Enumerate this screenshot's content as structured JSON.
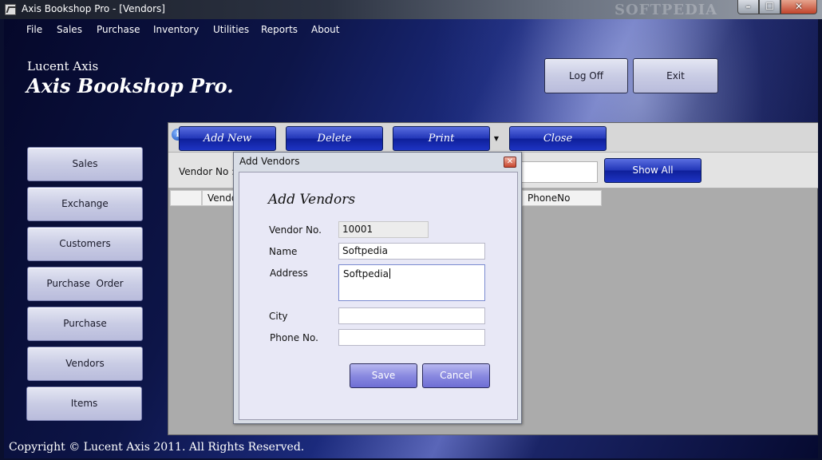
{
  "window": {
    "title": "Axis Bookshop Pro - [Vendors]",
    "watermark": "SOFTPEDIA",
    "controls": {
      "minimize": "–",
      "maximize": "☐",
      "close": "✕"
    }
  },
  "menu": [
    "File",
    "Sales",
    "Purchase",
    "Inventory",
    "Utilities",
    "Reports",
    "About"
  ],
  "brand": {
    "company": "Lucent Axis",
    "product": "Axis Bookshop Pro."
  },
  "header_buttons": {
    "log_off": "Log Off",
    "exit": "Exit"
  },
  "sidebar": [
    {
      "label": "Sales"
    },
    {
      "label": "Exchange"
    },
    {
      "label": "Customers"
    },
    {
      "label": "Purchase  Order"
    },
    {
      "label": "Purchase"
    },
    {
      "label": "Vendors"
    },
    {
      "label": "Items"
    }
  ],
  "toolbar": {
    "info_icon": "i",
    "add_new": "Add New",
    "delete": "Delete",
    "print": "Print",
    "print_arrow": "▼",
    "close": "Close"
  },
  "search": {
    "label": "Vendor No :",
    "show_all": "Show All"
  },
  "grid": {
    "columns": [
      "",
      "Vendo",
      "PhoneNo"
    ]
  },
  "dialog": {
    "title": "Add Vendors",
    "close_glyph": "✕",
    "heading": "Add Vendors",
    "fields": {
      "vendor_no": {
        "label": "Vendor No.",
        "value": "10001"
      },
      "name": {
        "label": "Name",
        "value": "Softpedia"
      },
      "address": {
        "label": "Address",
        "value": "Softpedia"
      },
      "city": {
        "label": "City",
        "value": ""
      },
      "phone": {
        "label": "Phone No.",
        "value": ""
      }
    },
    "save": "Save",
    "cancel": "Cancel"
  },
  "footer": "Copyright © Lucent Axis 2011. All Rights Reserved.",
  "colors": {
    "accent_blue": "#1e34c4",
    "panel_gray": "#ababab",
    "dialog_bg": "#e8e8f6"
  }
}
